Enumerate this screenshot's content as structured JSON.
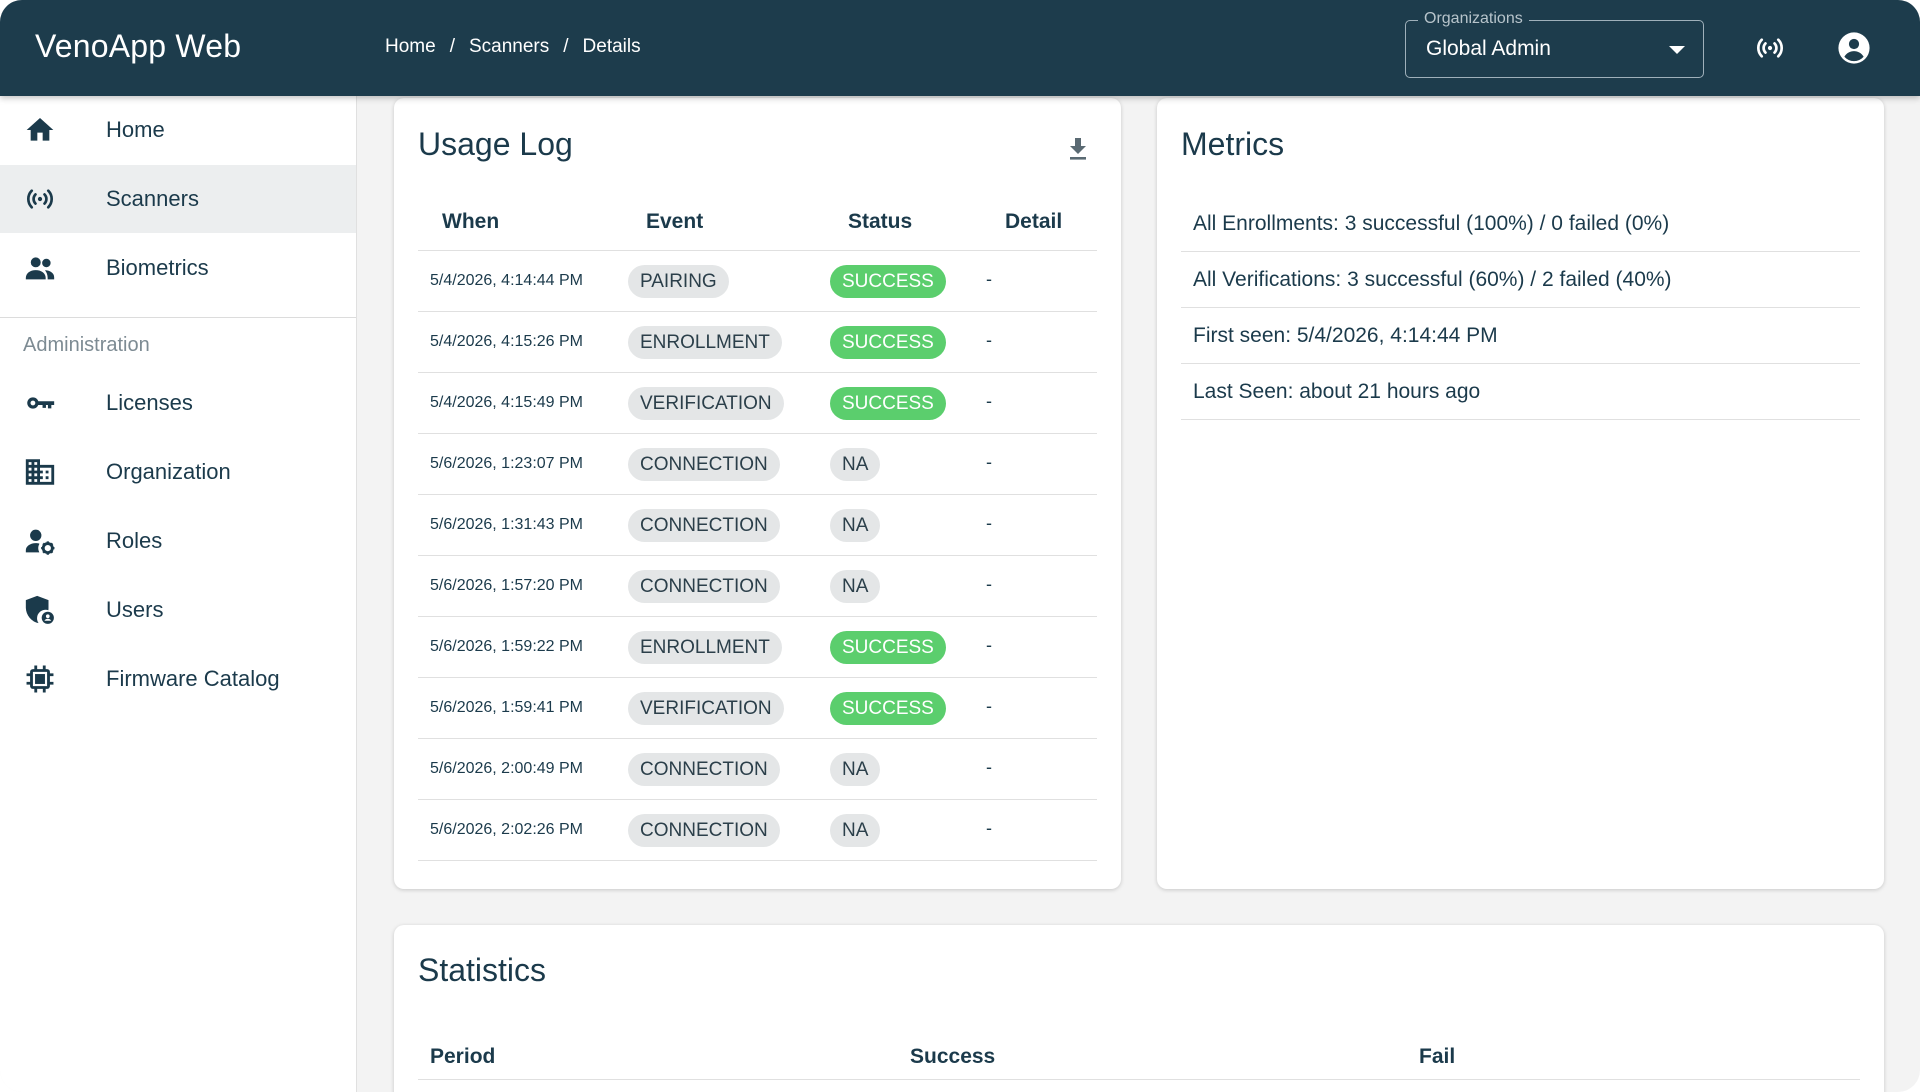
{
  "app": {
    "title": "VenoApp Web"
  },
  "breadcrumb": [
    "Home",
    "Scanners",
    "Details"
  ],
  "org_select": {
    "legend": "Organizations",
    "value": "Global Admin"
  },
  "icons": {
    "scanner": "sensors-icon",
    "account": "account-circle-icon",
    "download": "download-icon"
  },
  "sidebar": {
    "items": [
      {
        "label": "Home",
        "icon": "home-icon"
      },
      {
        "label": "Scanners",
        "icon": "sensors-icon",
        "active": true
      },
      {
        "label": "Biometrics",
        "icon": "people-icon"
      }
    ],
    "section_label": "Administration",
    "admin_items": [
      {
        "label": "Licenses",
        "icon": "key-icon"
      },
      {
        "label": "Organization",
        "icon": "building-icon"
      },
      {
        "label": "Roles",
        "icon": "user-settings-icon"
      },
      {
        "label": "Users",
        "icon": "shield-user-icon"
      },
      {
        "label": "Firmware Catalog",
        "icon": "chip-icon"
      }
    ]
  },
  "usage_log": {
    "title": "Usage Log",
    "columns": [
      "When",
      "Event",
      "Status",
      "Detail"
    ],
    "rows": [
      {
        "when": "5/4/2026, 4:14:44 PM",
        "event": "PAIRING",
        "status": "SUCCESS",
        "detail": "-"
      },
      {
        "when": "5/4/2026, 4:15:26 PM",
        "event": "ENROLLMENT",
        "status": "SUCCESS",
        "detail": "-"
      },
      {
        "when": "5/4/2026, 4:15:49 PM",
        "event": "VERIFICATION",
        "status": "SUCCESS",
        "detail": "-"
      },
      {
        "when": "5/6/2026, 1:23:07 PM",
        "event": "CONNECTION",
        "status": "NA",
        "detail": "-"
      },
      {
        "when": "5/6/2026, 1:31:43 PM",
        "event": "CONNECTION",
        "status": "NA",
        "detail": "-"
      },
      {
        "when": "5/6/2026, 1:57:20 PM",
        "event": "CONNECTION",
        "status": "NA",
        "detail": "-"
      },
      {
        "when": "5/6/2026, 1:59:22 PM",
        "event": "ENROLLMENT",
        "status": "SUCCESS",
        "detail": "-"
      },
      {
        "when": "5/6/2026, 1:59:41 PM",
        "event": "VERIFICATION",
        "status": "SUCCESS",
        "detail": "-"
      },
      {
        "when": "5/6/2026, 2:00:49 PM",
        "event": "CONNECTION",
        "status": "NA",
        "detail": "-"
      },
      {
        "when": "5/6/2026, 2:02:26 PM",
        "event": "CONNECTION",
        "status": "NA",
        "detail": "-"
      }
    ]
  },
  "metrics": {
    "title": "Metrics",
    "items": [
      "All Enrollments: 3 successful (100%) / 0 failed (0%)",
      "All Verifications: 3 successful (60%) / 2 failed (40%)",
      "First seen: 5/4/2026, 4:14:44 PM",
      "Last Seen: about 21 hours ago"
    ]
  },
  "statistics": {
    "title": "Statistics",
    "columns": [
      "Period",
      "Success",
      "Fail"
    ]
  },
  "colors": {
    "topbar": "#1d3c4c",
    "text": "#1b3a4b",
    "success": "#5bce6d",
    "chip_neutral": "#e4e6e7",
    "active_nav": "#eceeef"
  }
}
